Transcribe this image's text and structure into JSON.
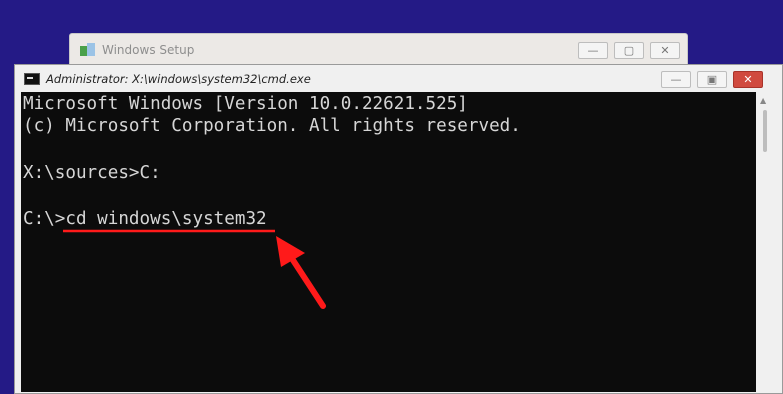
{
  "background_color": "#241a86",
  "setup_window": {
    "title": "Windows Setup",
    "controls": {
      "minimize": "—",
      "maximize": "▢",
      "close": "✕"
    }
  },
  "cmd_window": {
    "title": "Administrator: X:\\windows\\system32\\cmd.exe",
    "controls": {
      "minimize": "—",
      "maximize": "▣",
      "close": "✕"
    }
  },
  "console": {
    "lines": [
      "Microsoft Windows [Version 10.0.22621.525]",
      "(c) Microsoft Corporation. All rights reserved.",
      "",
      "X:\\sources>C:",
      "",
      "C:\\>cd windows\\system32"
    ],
    "text_color": "#d6d6d6",
    "background_color": "#0c0c0c"
  },
  "annotation": {
    "color": "#ff1a1a",
    "underline_target": "cd windows\\system32",
    "arrow_icon": "red-arrow-icon"
  }
}
